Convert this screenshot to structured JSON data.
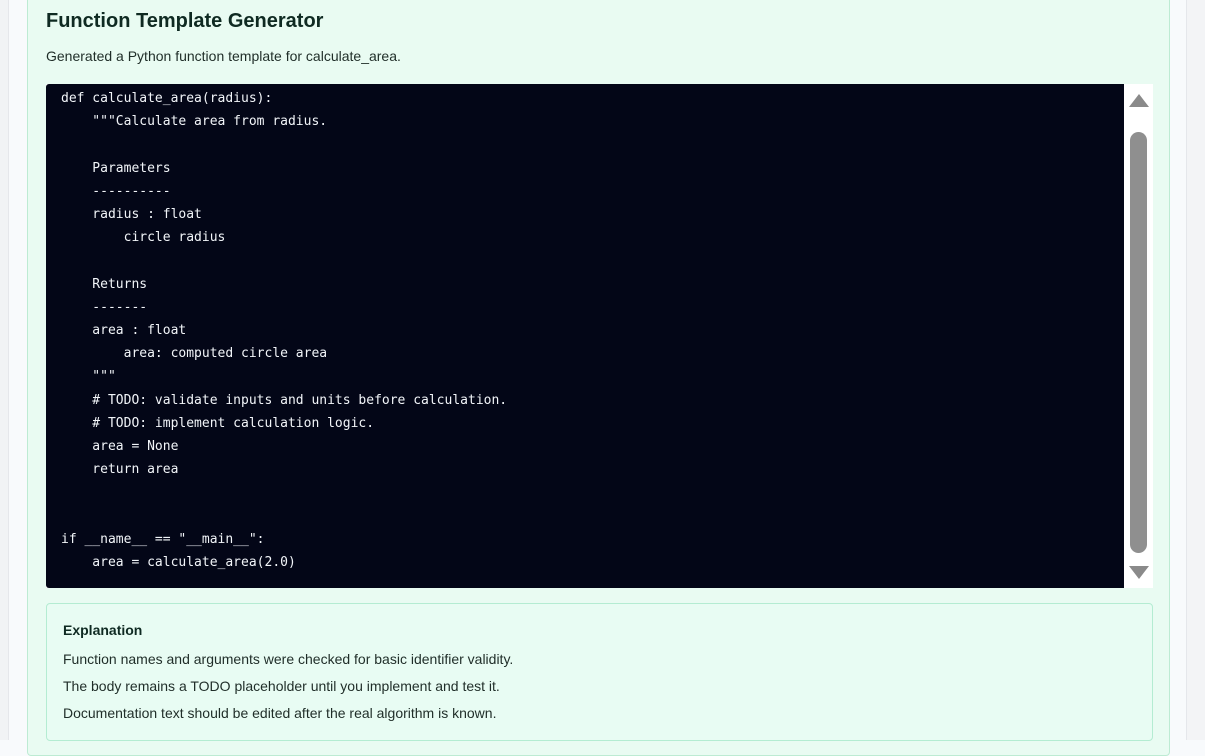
{
  "panel": {
    "title": "Function Template Generator",
    "subtitle": "Generated a Python function template for calculate_area."
  },
  "code": {
    "language": "python",
    "text": "def calculate_area(radius):\n    \"\"\"Calculate area from radius.\n\n    Parameters\n    ----------\n    radius : float\n        circle radius\n\n    Returns\n    -------\n    area : float\n        area: computed circle area\n    \"\"\"\n    # TODO: validate inputs and units before calculation.\n    # TODO: implement calculation logic.\n    area = None\n    return area\n\n\nif __name__ == \"__main__\":\n    area = calculate_area(2.0)"
  },
  "explanation": {
    "title": "Explanation",
    "items": [
      "Function names and arguments were checked for basic identifier validity.",
      "The body remains a TODO placeholder until you implement and test it.",
      "Documentation text should be edited after the real algorithm is known."
    ]
  },
  "icons": {
    "scroll_up": "triangle-up-icon",
    "scroll_down": "triangle-down-icon"
  },
  "colors": {
    "panel_background": "#e9fbf2",
    "code_background": "#030617",
    "code_text": "#f2f5f9",
    "scrollbar_thumb": "#8f8f8f"
  }
}
